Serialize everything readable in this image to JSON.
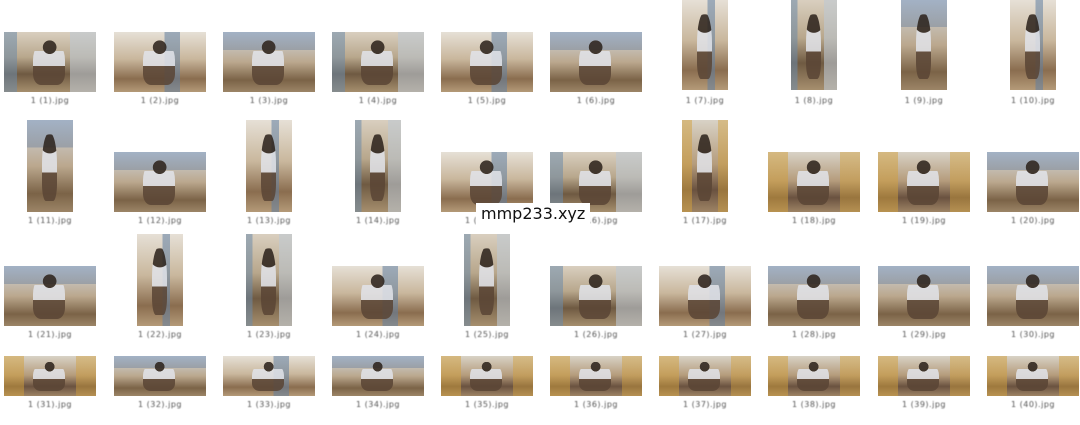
{
  "watermark": "mmp233.xyz",
  "rows": [
    {
      "files": [
        {
          "name": "1 (1).jpg",
          "orientation": "landscape",
          "theme": "a"
        },
        {
          "name": "1 (2).jpg",
          "orientation": "landscape",
          "theme": "b"
        },
        {
          "name": "1 (3).jpg",
          "orientation": "landscape",
          "theme": "c"
        },
        {
          "name": "1 (4).jpg",
          "orientation": "landscape",
          "theme": "a"
        },
        {
          "name": "1 (5).jpg",
          "orientation": "landscape",
          "theme": "b"
        },
        {
          "name": "1 (6).jpg",
          "orientation": "landscape",
          "theme": "c"
        },
        {
          "name": "1 (7).jpg",
          "orientation": "portrait",
          "theme": "b"
        },
        {
          "name": "1 (8).jpg",
          "orientation": "portrait",
          "theme": "a"
        },
        {
          "name": "1 (9).jpg",
          "orientation": "portrait",
          "theme": "c"
        },
        {
          "name": "1 (10).jpg",
          "orientation": "portrait",
          "theme": "b"
        }
      ]
    },
    {
      "files": [
        {
          "name": "1 (11).jpg",
          "orientation": "portrait",
          "theme": "c"
        },
        {
          "name": "1 (12).jpg",
          "orientation": "landscape",
          "theme": "c"
        },
        {
          "name": "1 (13).jpg",
          "orientation": "portrait",
          "theme": "b"
        },
        {
          "name": "1 (14).jpg",
          "orientation": "portrait",
          "theme": "a"
        },
        {
          "name": "1 (15).jpg",
          "orientation": "landscape",
          "theme": "b"
        },
        {
          "name": "1 (16).jpg",
          "orientation": "landscape",
          "theme": "a"
        },
        {
          "name": "1 (17).jpg",
          "orientation": "portrait",
          "theme": "d"
        },
        {
          "name": "1 (18).jpg",
          "orientation": "landscape",
          "theme": "d"
        },
        {
          "name": "1 (19).jpg",
          "orientation": "landscape",
          "theme": "d"
        },
        {
          "name": "1 (20).jpg",
          "orientation": "landscape",
          "theme": "c"
        }
      ]
    },
    {
      "files": [
        {
          "name": "1 (21).jpg",
          "orientation": "landscape",
          "theme": "c"
        },
        {
          "name": "1 (22).jpg",
          "orientation": "portrait",
          "theme": "b"
        },
        {
          "name": "1 (23).jpg",
          "orientation": "portrait",
          "theme": "a"
        },
        {
          "name": "1 (24).jpg",
          "orientation": "landscape",
          "theme": "b"
        },
        {
          "name": "1 (25).jpg",
          "orientation": "portrait",
          "theme": "a"
        },
        {
          "name": "1 (26).jpg",
          "orientation": "landscape",
          "theme": "a"
        },
        {
          "name": "1 (27).jpg",
          "orientation": "landscape",
          "theme": "b"
        },
        {
          "name": "1 (28).jpg",
          "orientation": "landscape",
          "theme": "c"
        },
        {
          "name": "1 (29).jpg",
          "orientation": "landscape",
          "theme": "c"
        },
        {
          "name": "1 (30).jpg",
          "orientation": "landscape",
          "theme": "c"
        }
      ]
    },
    {
      "files": [
        {
          "name": "1 (31).jpg",
          "orientation": "landscape",
          "theme": "d"
        },
        {
          "name": "1 (32).jpg",
          "orientation": "landscape",
          "theme": "c"
        },
        {
          "name": "1 (33).jpg",
          "orientation": "landscape",
          "theme": "b"
        },
        {
          "name": "1 (34).jpg",
          "orientation": "landscape",
          "theme": "c"
        },
        {
          "name": "1 (35).jpg",
          "orientation": "landscape",
          "theme": "d"
        },
        {
          "name": "1 (36).jpg",
          "orientation": "landscape",
          "theme": "d"
        },
        {
          "name": "1 (37).jpg",
          "orientation": "landscape",
          "theme": "d"
        },
        {
          "name": "1 (38).jpg",
          "orientation": "landscape",
          "theme": "d"
        },
        {
          "name": "1 (39).jpg",
          "orientation": "landscape",
          "theme": "d"
        },
        {
          "name": "1 (40).jpg",
          "orientation": "landscape",
          "theme": "d"
        }
      ]
    }
  ]
}
